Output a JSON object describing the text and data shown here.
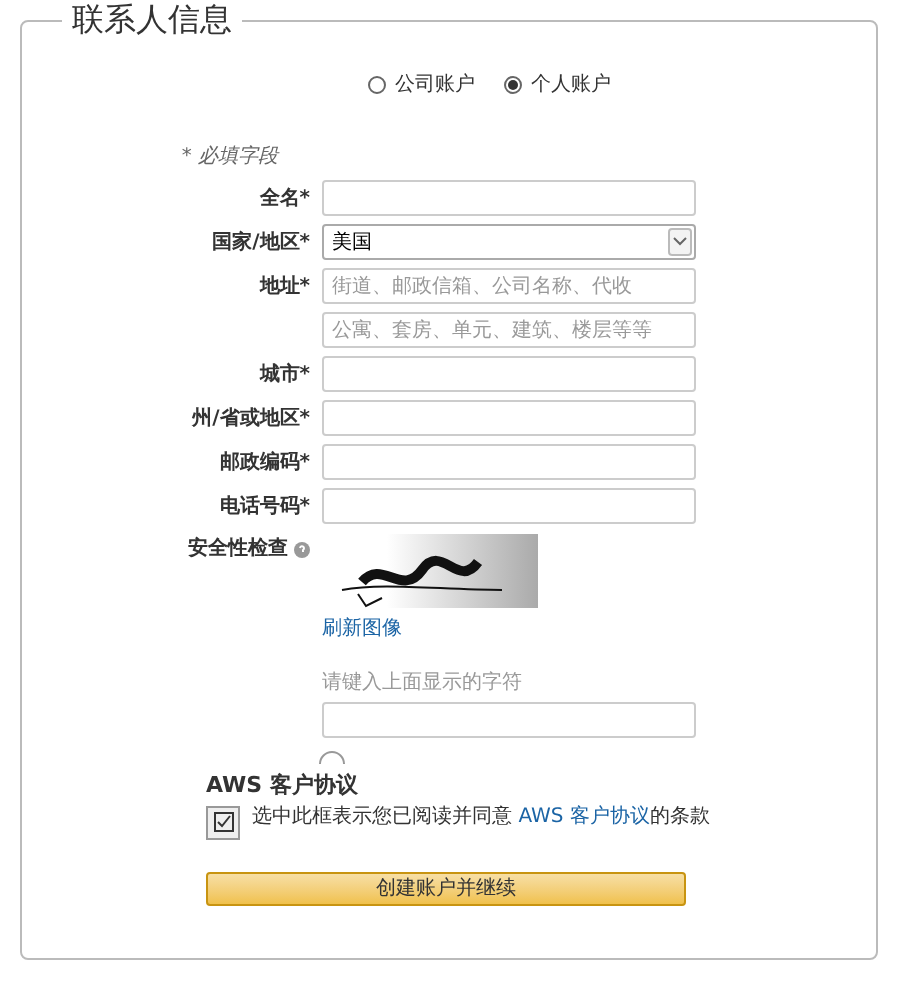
{
  "legend": "联系人信息",
  "account_types": [
    {
      "label": "公司账户",
      "selected": false
    },
    {
      "label": "个人账户",
      "selected": true
    }
  ],
  "required_note": "* 必填字段",
  "fields": [
    {
      "kind": "text",
      "label": "全名*"
    },
    {
      "kind": "select",
      "label": "国家/地区*",
      "value": "美国"
    },
    {
      "kind": "text",
      "label": "地址*",
      "placeholder": "街道、邮政信箱、公司名称、代收"
    },
    {
      "kind": "text",
      "placeholder": "公寓、套房、单元、建筑、楼层等等"
    },
    {
      "kind": "text",
      "label": "城市*"
    },
    {
      "kind": "text",
      "label": "州/省或地区*"
    },
    {
      "kind": "text",
      "label": "邮政编码*"
    },
    {
      "kind": "text",
      "label": "电话号码*"
    }
  ],
  "security": {
    "label": "安全性检查",
    "refresh_link": "刷新图像",
    "hint": "请键入上面显示的字符"
  },
  "agreement": {
    "title": "AWS 客户协议",
    "checked": true,
    "text_before": "选中此框表示您已阅读并同意 ",
    "link": "AWS 客户协议",
    "text_after": "的条款"
  },
  "submit": "创建账户并继续"
}
